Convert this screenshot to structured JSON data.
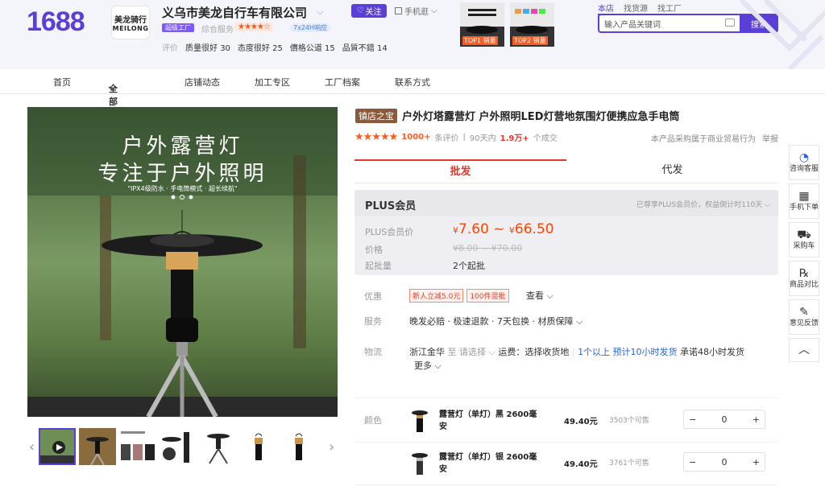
{
  "header": {
    "logo": "1688",
    "shop_logo_cn": "美龙骑行",
    "shop_logo_en": "MEILONG",
    "shop_name": "义乌市美龙自行车有限公司",
    "follow": "关注",
    "mobile_shop": "手机逛",
    "super_factory": "超级工厂",
    "service_label": "综合服务",
    "service_stars": "★★★★☆",
    "response_badge": "7x24H响应",
    "ratings": [
      {
        "label": "评价",
        "value": ""
      },
      {
        "label": "质量很好",
        "value": "30"
      },
      {
        "label": "态度很好",
        "value": "25"
      },
      {
        "label": "價格公道",
        "value": "15"
      },
      {
        "label": "品質不錯",
        "value": "14"
      }
    ],
    "banner1_tag": "TOP1 销量",
    "banner2_tag": "TOP2 销量",
    "search_tabs": [
      "本店",
      "找货源",
      "找工厂"
    ],
    "search_placeholder": "输入产品关键词",
    "search_button": "搜索"
  },
  "nav": {
    "items": [
      "首页",
      "全部商品",
      "店铺动态",
      "加工专区",
      "工厂档案",
      "联系方式"
    ]
  },
  "image": {
    "main_line1": "户外露营灯",
    "main_line2": "专注于户外照明",
    "main_sub": "\"IPX4级防水 · 手电筒模式 · 超长续航\""
  },
  "product": {
    "title_tag": "镇店之宝",
    "title": "户外灯塔露营灯 户外照明LED灯营地氛围灯便携应急手电筒",
    "stars": "★★★★★",
    "reviews_num": "1000+",
    "reviews_label": "条评价",
    "period": "90天内",
    "sold": "1.9万+",
    "sold_label": "个成交",
    "policy": "本产品采购属于商业贸易行为",
    "report": "举报",
    "tab_wholesale": "批发",
    "tab_dropship": "代发"
  },
  "plus": {
    "title": "PLUS会员",
    "expire": "已尊享PLUS会员价，权益倒计时110天",
    "price_label": "PLUS会员价",
    "price_low": "7.60",
    "price_high": "66.50",
    "orig_label": "价格",
    "orig_price": "¥8.00 ~ ¥70.00",
    "moq_label": "起批量",
    "moq_value": "2个起批"
  },
  "info": {
    "discount_label": "优惠",
    "coupon1": "新人立减5.0元",
    "coupon2": "100件混批",
    "view": "查看",
    "service_label": "服务",
    "service_value": "晚发必赔 · 极速退款 · 7天包换 · 材质保障",
    "logistics_label": "物流",
    "from": "浙江金华",
    "to_label": "至",
    "to_select": "请选择",
    "freight": "运费：选择收货地",
    "ship_link": "1个以上 预计10小时发货",
    "promise": "承诺48小时发货",
    "more": "更多"
  },
  "sku": {
    "label": "颜色",
    "items": [
      {
        "name": "露营灯（单灯）黑 2600毫安",
        "price": "49.40元",
        "stock": "3503个可售",
        "qty": "0"
      },
      {
        "name": "露营灯（单灯）银 2600毫安",
        "price": "49.40元",
        "stock": "3761个可售",
        "qty": "0"
      }
    ]
  },
  "sidebar": {
    "items": [
      {
        "label": "咨询客服",
        "icon": "chat-icon"
      },
      {
        "label": "手机下单",
        "icon": "qr-icon"
      },
      {
        "label": "采购车",
        "icon": "cart-icon"
      },
      {
        "label": "商品对比",
        "icon": "compare-icon"
      },
      {
        "label": "意见反馈",
        "icon": "edit-icon"
      }
    ]
  },
  "colors": {
    "accent": "#5b3fd8",
    "price": "#ff4400",
    "red": "#e5382b"
  }
}
